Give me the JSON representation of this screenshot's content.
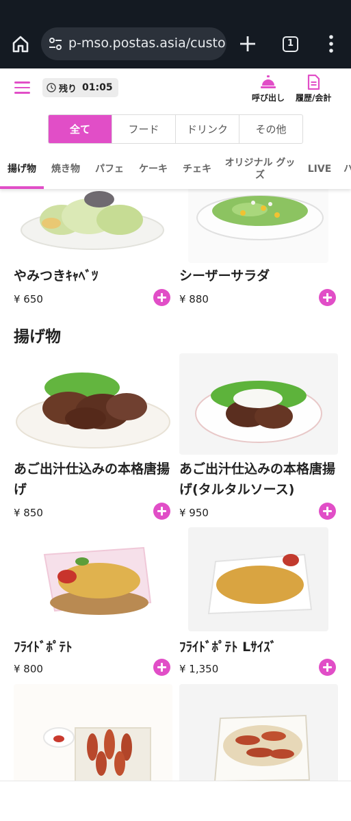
{
  "browser": {
    "url": "p-mso.postas.asia/customer",
    "tab_count": "1"
  },
  "header": {
    "timer_label": "残り",
    "timer_value": "01:05",
    "call_label": "呼び出し",
    "history_label": "履歴/会計"
  },
  "segments": [
    {
      "label": "全て",
      "active": true
    },
    {
      "label": "フード",
      "active": false
    },
    {
      "label": "ドリンク",
      "active": false
    },
    {
      "label": "その他",
      "active": false
    }
  ],
  "category_tabs": [
    {
      "label": "揚げ物",
      "active": true
    },
    {
      "label": "焼き物"
    },
    {
      "label": "パフェ"
    },
    {
      "label": "ケーキ"
    },
    {
      "label": "チェキ"
    },
    {
      "label": "オリジナル グッズ"
    },
    {
      "label": "LIVE"
    },
    {
      "label": "ハ"
    }
  ],
  "sections": [
    {
      "title": "揚げ物"
    }
  ],
  "items": [
    {
      "name": "やみつきｷｬﾍﾞﾂ",
      "price": "¥ 650"
    },
    {
      "name": "シーザーサラダ",
      "price": "¥ 880"
    },
    {
      "name": "あご出汁仕込みの本格唐揚げ",
      "price": "¥ 850"
    },
    {
      "name": "あご出汁仕込みの本格唐揚げ(タルタルソース)",
      "price": "¥ 950"
    },
    {
      "name": "ﾌﾗｲﾄﾞﾎﾟﾃﾄ",
      "price": "¥ 800"
    },
    {
      "name": "ﾌﾗｲﾄﾞﾎﾟﾃﾄ Lｻｲｽﾞ",
      "price": "¥ 1,350"
    }
  ],
  "colors": {
    "accent": "#e14ec7",
    "browser_bar": "#141a22"
  }
}
